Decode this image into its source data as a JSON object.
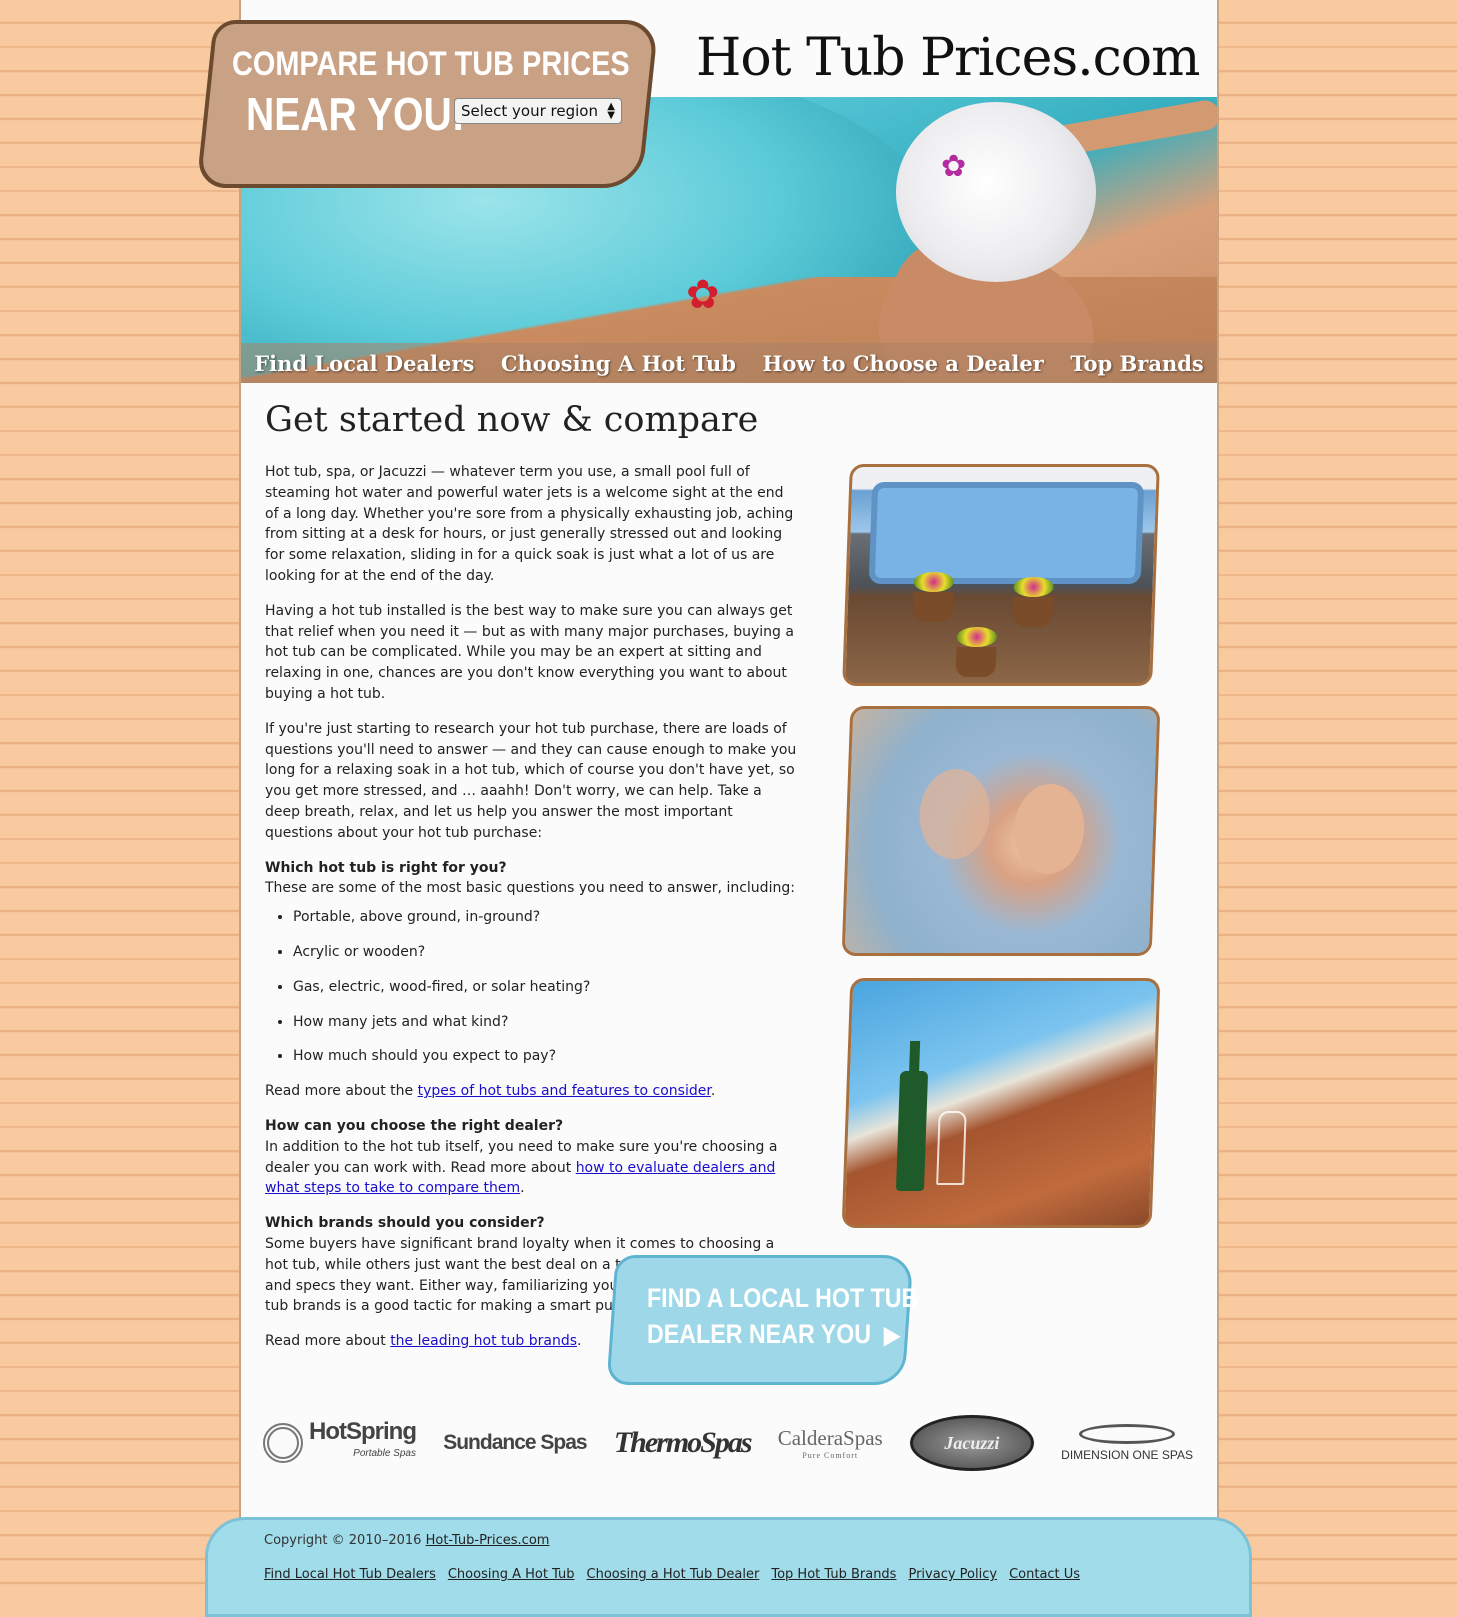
{
  "site": {
    "title": "Hot Tub Prices.com"
  },
  "compare_badge": {
    "line1": "COMPARE HOT TUB PRICES",
    "line2": "NEAR YOU:",
    "region_select": "Select your region"
  },
  "nav": [
    "Find Local Dealers",
    "Choosing A Hot Tub",
    "How to Choose a Dealer",
    "Top Brands"
  ],
  "main": {
    "headline": "Get started now & compare",
    "p1": "Hot tub, spa, or Jacuzzi — whatever term you use, a small pool full of steaming hot water and powerful water jets is a welcome sight at the end of a long day. Whether you're sore from a physically exhausting job, aching from sitting at a desk for hours, or just generally stressed out and looking for some relaxation, sliding in for a quick soak is just what a lot of us are looking for at the end of the day.",
    "p2": "Having a hot tub installed is the best way to make sure you can always get that relief when you need it — but as with many major purchases, buying a hot tub can be complicated. While you may be an expert at sitting and relaxing in one, chances are you don't know everything you want to about buying a hot tub.",
    "p3": "If you're just starting to research your hot tub purchase, there are loads of questions you'll need to answer — and they can cause enough to make you long for a relaxing soak in a hot tub, which of course you don't have yet, so you get more stressed, and … aaahh! Don't worry, we can help. Take a deep breath, relax, and let us help you answer the most important questions about your hot tub purchase:",
    "q1_heading": "Which hot tub is right for you?",
    "q1_intro": "These are some of the most basic questions you need to answer, including:",
    "q1_list": [
      "Portable, above ground, in-ground?",
      "Acrylic or wooden?",
      "Gas, electric, wood-fired, or solar heating?",
      "How many jets and what kind?",
      "How much should you expect to pay?"
    ],
    "q1_more_prefix": "Read more about the ",
    "q1_more_link": "types of hot tubs and features to consider",
    "q1_more_suffix": ".",
    "q2_heading": "How can you choose the right dealer?",
    "q2_text_prefix": "In addition to the hot tub itself, you need to make sure you're choosing a dealer you can work with. Read more about ",
    "q2_link": "how to evaluate dealers and what steps to take to compare them",
    "q2_suffix": ".",
    "q3_heading": "Which brands should you consider?",
    "q3_text": "Some buyers have significant brand loyalty when it comes to choosing a hot tub, while others just want the best deal on a tub that has the features and specs they want. Either way, familiarizing yourself with the major hot tub brands is a good tactic for making a smart purchase.",
    "q3_more_prefix": "Read more about ",
    "q3_more_link": "the leading hot tub brands",
    "q3_more_suffix": "."
  },
  "cta": {
    "line1": "FIND A LOCAL HOT TUB",
    "line2": "DEALER NEAR YOU",
    "arrow": "▶"
  },
  "brands": {
    "hotspring": "HotSpring",
    "hotspring_sub": "Portable Spas",
    "sundance": "Sundance Spas",
    "thermospas": "ThermoSpas",
    "caldera": "CalderaSpas",
    "caldera_sub": "Pure Comfort",
    "jacuzzi": "Jacuzzi",
    "dimension_one": "DIMENSION ONE SPAS"
  },
  "footer": {
    "copyright_prefix": "Copyright © 2010–2016 ",
    "copyright_link": "Hot-Tub-Prices.com",
    "links": [
      "Find Local Hot Tub Dealers",
      "Choosing A Hot Tub",
      "Choosing a Hot Tub Dealer",
      "Top Hot Tub Brands",
      "Privacy Policy",
      "Contact Us"
    ]
  },
  "colors": {
    "background": "#f7c59a",
    "badge": "#c9a184",
    "cta": "#9ed7e8",
    "footer": "#a1dceb",
    "link": "#1a0dcc"
  }
}
